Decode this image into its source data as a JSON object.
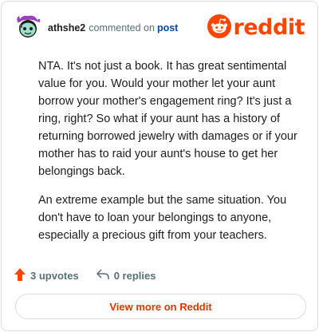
{
  "header": {
    "username": "athshe2",
    "action_text": "commented on",
    "post_link": "post",
    "logo_text": "reddit",
    "avatar_icon": "snoo-avatar-icon",
    "logo_icon": "reddit-snoo-icon"
  },
  "comment": {
    "paragraphs": [
      "NTA. It's not just a book. It has great sentimental value for you. Would your mother let your aunt borrow your mother's engagement ring? It's just a ring, right? So what if your aunt has a history of returning borrowed jewelry with damages or if your mother has to raid your aunt's house to get her belongings back.",
      "An extreme example but the same situation. You don't have to loan your belongings to anyone, especially a precious gift from your teachers."
    ]
  },
  "actions": {
    "upvotes": "3 upvotes",
    "replies": "0 replies",
    "upvote_icon": "upvote-arrow-icon",
    "reply_icon": "reply-arrow-icon"
  },
  "footer": {
    "view_more": "View more on Reddit"
  },
  "colors": {
    "brand": "#ff4500",
    "link": "#0a449b",
    "muted": "#576f76",
    "button_text": "#d93900"
  }
}
